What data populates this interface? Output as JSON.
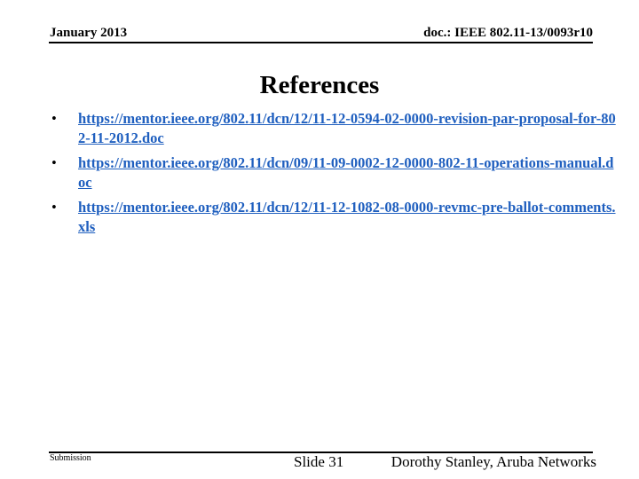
{
  "header": {
    "date": "January 2013",
    "doc_id": "doc.: IEEE 802.11-13/0093r10"
  },
  "title": "References",
  "references": [
    {
      "text": "https://mentor.ieee.org/802.11/dcn/12/11-12-0594-02-0000-revision-par-proposal-for-802-11-2012.doc"
    },
    {
      "text": "https://mentor.ieee.org/802.11/dcn/09/11-09-0002-12-0000-802-11-operations-manual.doc"
    },
    {
      "text": "https://mentor.ieee.org/802.11/dcn/12/11-12-1082-08-0000-revmc-pre-ballot-comments.xls"
    }
  ],
  "bullet_glyph": "•",
  "footer": {
    "left": "Submission",
    "slide": "Slide 31",
    "author": "Dorothy Stanley, Aruba Networks"
  }
}
